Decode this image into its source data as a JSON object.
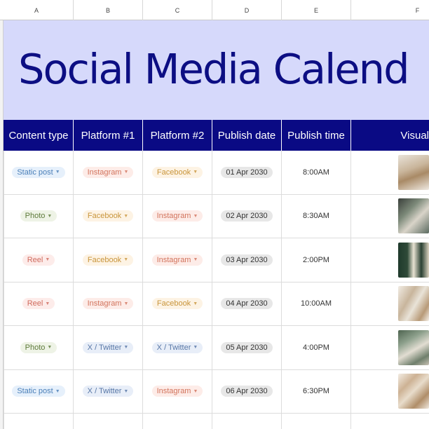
{
  "columns": [
    "A",
    "B",
    "C",
    "D",
    "E",
    "F"
  ],
  "title": "Social Media Calend",
  "headers": [
    "Content type",
    "Platform #1",
    "Platform #2",
    "Publish date",
    "Publish time",
    "Visual"
  ],
  "rows": [
    {
      "content_type": "Static post",
      "platform1": "Instagram",
      "platform2": "Facebook",
      "date": "01 Apr 2030",
      "time": "8:00AM"
    },
    {
      "content_type": "Photo",
      "platform1": "Facebook",
      "platform2": "Instagram",
      "date": "02 Apr 2030",
      "time": "8:30AM"
    },
    {
      "content_type": "Reel",
      "platform1": "Facebook",
      "platform2": "Instagram",
      "date": "03 Apr 2030",
      "time": "2:00PM"
    },
    {
      "content_type": "Reel",
      "platform1": "Instagram",
      "platform2": "Facebook",
      "date": "04 Apr 2030",
      "time": "10:00AM"
    },
    {
      "content_type": "Photo",
      "platform1": "X / Twitter",
      "platform2": "X / Twitter",
      "date": "05 Apr 2030",
      "time": "4:00PM"
    },
    {
      "content_type": "Static post",
      "platform1": "X / Twitter",
      "platform2": "Instagram",
      "date": "06 Apr 2030",
      "time": "6:30PM"
    }
  ],
  "colors": {
    "banner_bg": "#d6d9fb",
    "title": "#0c0e83",
    "header_bg": "#0a0a84"
  },
  "icons": {
    "dropdown": "chevron-down-icon"
  }
}
